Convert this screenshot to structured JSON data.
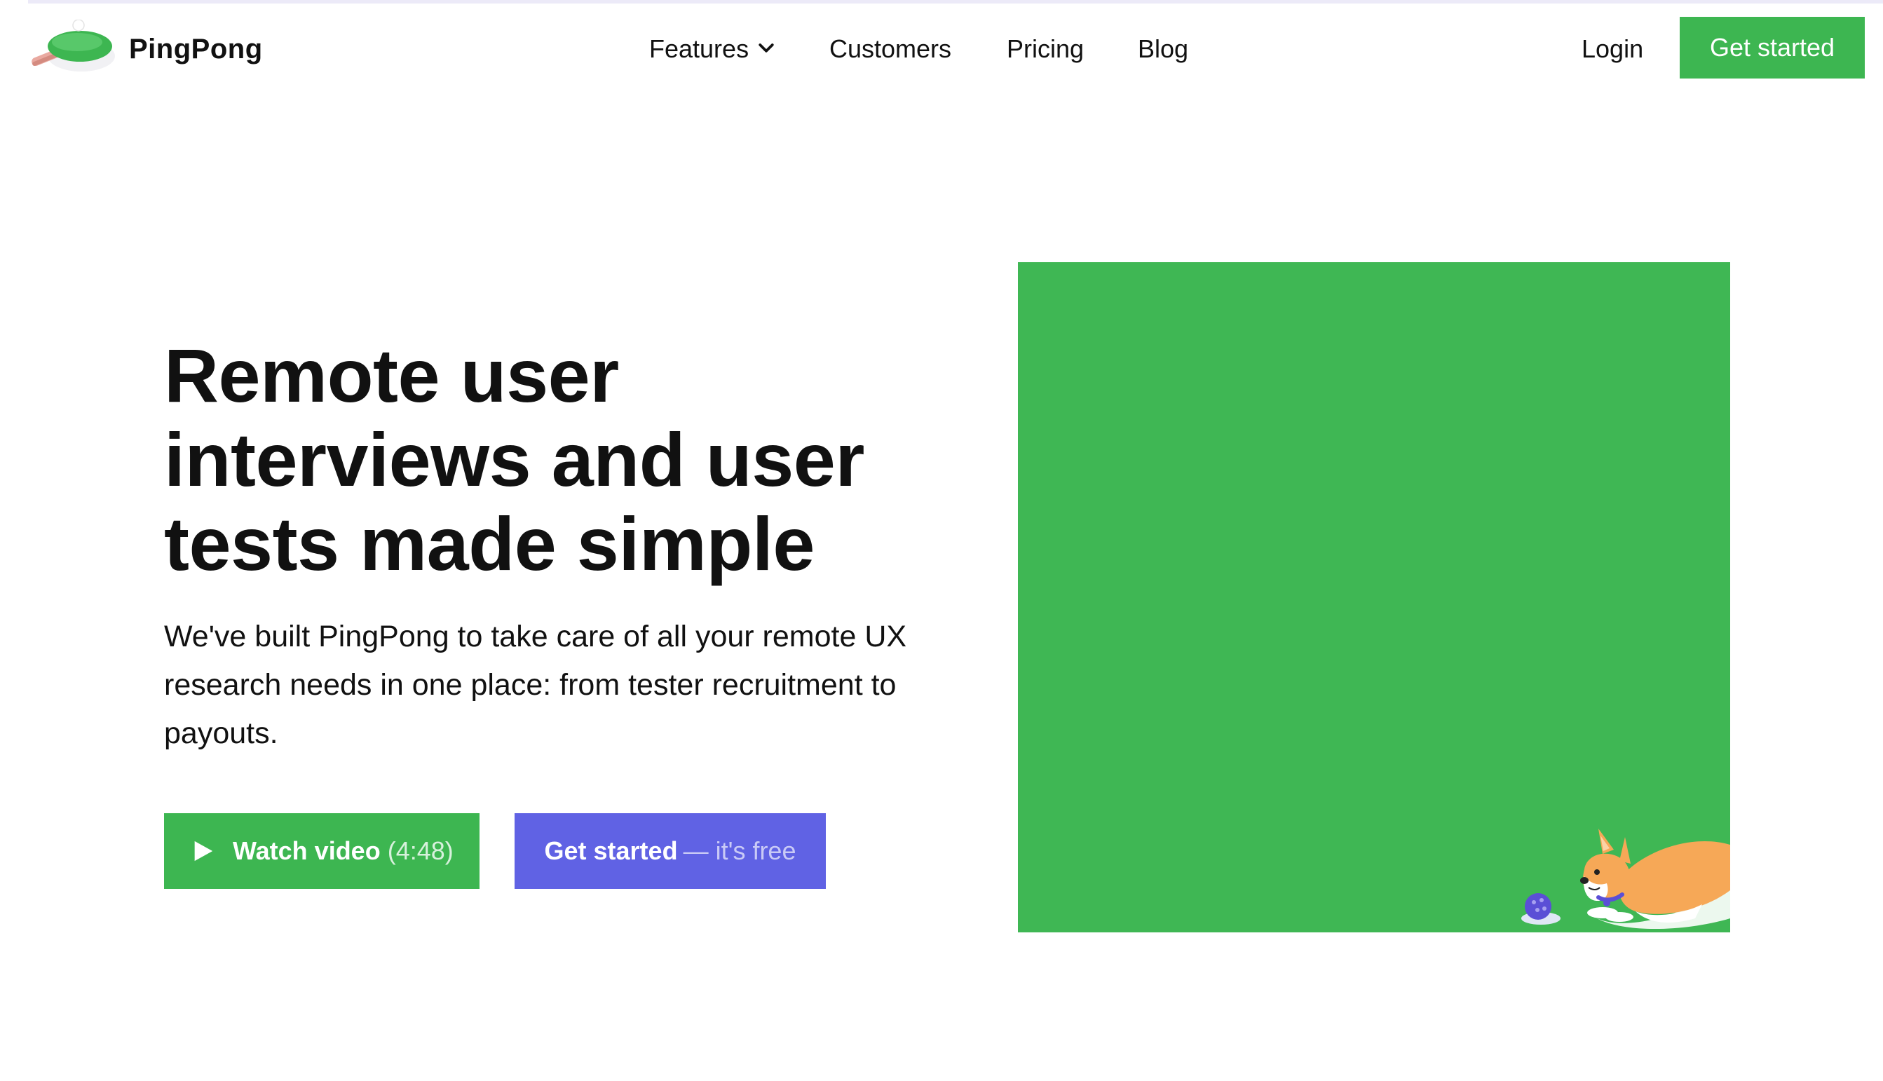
{
  "brand": {
    "name": "PingPong",
    "logo_icon": "ping-pong-paddle-icon"
  },
  "nav": {
    "items": [
      {
        "label": "Features",
        "has_dropdown": true
      },
      {
        "label": "Customers"
      },
      {
        "label": "Pricing"
      },
      {
        "label": "Blog"
      }
    ],
    "login_label": "Login",
    "cta_label": "Get started"
  },
  "hero": {
    "title_lines": [
      "Remote user",
      "interviews and user",
      "tests made simple"
    ],
    "subtitle": "We've built PingPong to take care of all your remote UX research needs in one place: from tester recruitment to payouts.",
    "watch_video": {
      "label": "Watch video",
      "duration": "(4:48)",
      "icon": "play-icon"
    },
    "get_started": {
      "label": "Get started",
      "suffix": "— it's free"
    },
    "illustration": "corgi-with-ball"
  },
  "colors": {
    "green": "#3db651",
    "purple": "#6062e4",
    "text": "#111111"
  }
}
